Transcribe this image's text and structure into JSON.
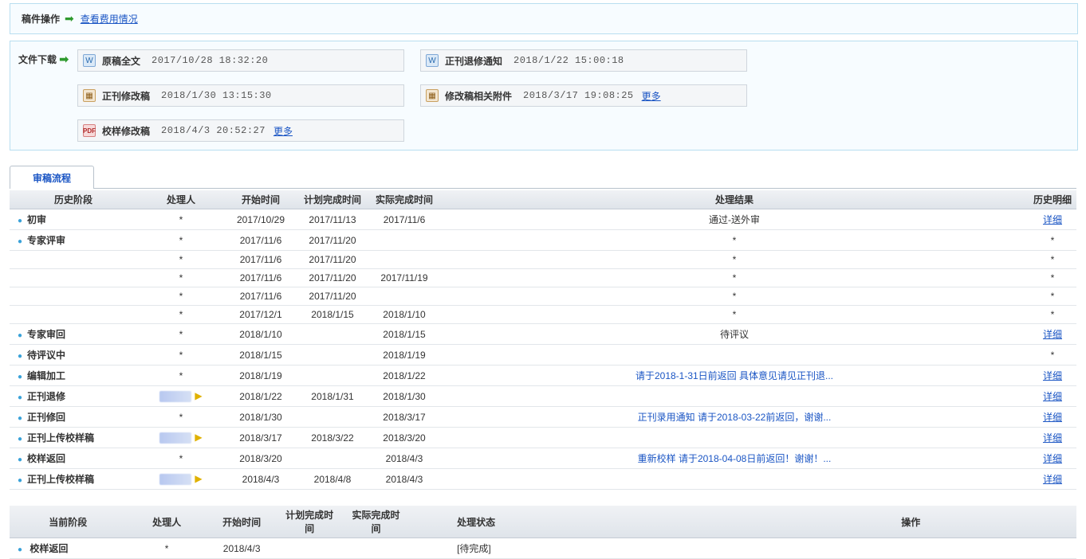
{
  "ops": {
    "label": "稿件操作",
    "fee_link": "查看费用情况"
  },
  "download": {
    "label": "文件下载",
    "more": "更多",
    "files_left": [
      {
        "icon": "word",
        "name": "原稿全文",
        "time": "2017/10/28 18:32:20",
        "more": false
      },
      {
        "icon": "rar",
        "name": "正刊修改稿",
        "time": "2018/1/30 13:15:30",
        "more": false
      },
      {
        "icon": "pdf",
        "name": "校样修改稿",
        "time": "2018/4/3 20:52:27",
        "more": true
      }
    ],
    "files_right": [
      {
        "icon": "word",
        "name": "正刊退修通知",
        "time": "2018/1/22 15:00:18",
        "more": false
      },
      {
        "icon": "rar",
        "name": "修改稿相关附件",
        "time": "2018/3/17 19:08:25",
        "more": true
      }
    ]
  },
  "tab": {
    "label": "审稿流程"
  },
  "history": {
    "headers": {
      "stage": "历史阶段",
      "handler": "处理人",
      "start": "开始时间",
      "plan": "计划完成时间",
      "actual": "实际完成时间",
      "result": "处理结果",
      "detail": "历史明细"
    },
    "detail_label": "详细",
    "rows": [
      {
        "stage": "初审",
        "bullet": true,
        "handler": "*",
        "start": "2017/10/29",
        "plan": "2017/11/13",
        "actual": "2017/11/6",
        "result": "通过-送外审",
        "result_link": false,
        "detail": "link"
      },
      {
        "stage": "专家评审",
        "bullet": true,
        "handler": "*",
        "start": "2017/11/6",
        "plan": "2017/11/20",
        "actual": "",
        "result": "*",
        "result_link": false,
        "detail": "*"
      },
      {
        "stage": "",
        "bullet": false,
        "handler": "*",
        "start": "2017/11/6",
        "plan": "2017/11/20",
        "actual": "",
        "result": "*",
        "result_link": false,
        "detail": "*"
      },
      {
        "stage": "",
        "bullet": false,
        "handler": "*",
        "start": "2017/11/6",
        "plan": "2017/11/20",
        "actual": "2017/11/19",
        "result": "*",
        "result_link": false,
        "detail": "*"
      },
      {
        "stage": "",
        "bullet": false,
        "handler": "*",
        "start": "2017/11/6",
        "plan": "2017/11/20",
        "actual": "",
        "result": "*",
        "result_link": false,
        "detail": "*"
      },
      {
        "stage": "",
        "bullet": false,
        "handler": "*",
        "start": "2017/12/1",
        "plan": "2018/1/15",
        "actual": "2018/1/10",
        "result": "*",
        "result_link": false,
        "detail": "*"
      },
      {
        "stage": "专家审回",
        "bullet": true,
        "handler": "*",
        "start": "2018/1/10",
        "plan": "",
        "actual": "2018/1/15",
        "result": "待评议",
        "result_link": false,
        "detail": "link"
      },
      {
        "stage": "待评议中",
        "bullet": true,
        "handler": "*",
        "start": "2018/1/15",
        "plan": "",
        "actual": "2018/1/19",
        "result": "",
        "result_link": false,
        "detail": "*"
      },
      {
        "stage": "编辑加工",
        "bullet": true,
        "handler": "*",
        "start": "2018/1/19",
        "plan": "",
        "actual": "2018/1/22",
        "result": "请于2018-1-31日前返回 具体意见请见正刊退...",
        "result_link": true,
        "detail": "link"
      },
      {
        "stage": "正刊退修",
        "bullet": true,
        "handler": "blur",
        "start": "2018/1/22",
        "plan": "2018/1/31",
        "actual": "2018/1/30",
        "result": "",
        "result_link": false,
        "detail": "link"
      },
      {
        "stage": "正刊修回",
        "bullet": true,
        "handler": "*",
        "start": "2018/1/30",
        "plan": "",
        "actual": "2018/3/17",
        "result": "正刊录用通知 请于2018-03-22前返回，谢谢...",
        "result_link": true,
        "detail": "link"
      },
      {
        "stage": "正刊上传校样稿",
        "bullet": true,
        "handler": "blur",
        "start": "2018/3/17",
        "plan": "2018/3/22",
        "actual": "2018/3/20",
        "result": "",
        "result_link": false,
        "detail": "link"
      },
      {
        "stage": "校样返回",
        "bullet": true,
        "handler": "*",
        "start": "2018/3/20",
        "plan": "",
        "actual": "2018/4/3",
        "result": "重新校样 请于2018-04-08日前返回！谢谢！...",
        "result_link": true,
        "detail": "link"
      },
      {
        "stage": "正刊上传校样稿",
        "bullet": true,
        "handler": "blur",
        "start": "2018/4/3",
        "plan": "2018/4/8",
        "actual": "2018/4/3",
        "result": "",
        "result_link": false,
        "detail": "link"
      }
    ]
  },
  "current": {
    "headers": {
      "stage": "当前阶段",
      "handler": "处理人",
      "start": "开始时间",
      "plan": "计划完成时间",
      "actual": "实际完成时间",
      "status": "处理状态",
      "ops": "操作"
    },
    "row": {
      "stage": "校样返回",
      "handler": "*",
      "start": "2018/4/3",
      "plan": "",
      "actual": "",
      "status": "[待完成]",
      "ops": ""
    }
  }
}
